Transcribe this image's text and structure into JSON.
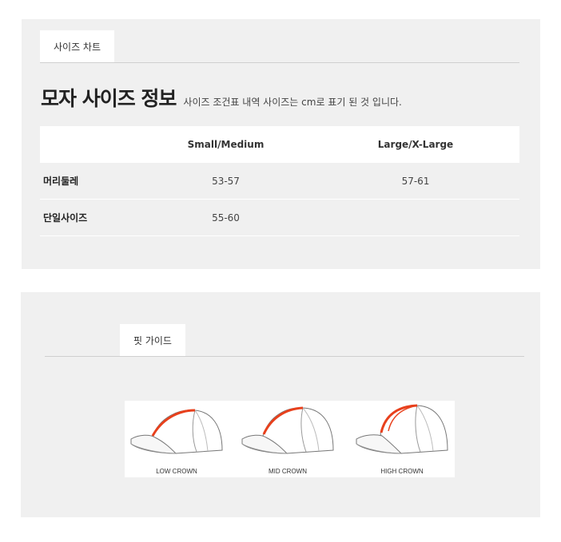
{
  "size_chart": {
    "tab_label": "사이즈 차트",
    "title": "모자 사이즈 정보",
    "subtitle": "사이즈 조건표 내역 사이즈는 cm로 표기 된 것 입니다.",
    "table": {
      "columns": [
        "",
        "Small/Medium",
        "Large/X-Large"
      ],
      "rows": [
        {
          "label": "머리둘레",
          "values": [
            "53-57",
            "57-61"
          ]
        },
        {
          "label": "단일사이즈",
          "values": [
            "55-60",
            ""
          ]
        }
      ]
    }
  },
  "fit_guide": {
    "tab_label": "핏 가이드",
    "crowns": [
      {
        "label": "LOW CROWN",
        "icon": "low-crown-cap-icon"
      },
      {
        "label": "MID CROWN",
        "icon": "mid-crown-cap-icon"
      },
      {
        "label": "HIGH CROWN",
        "icon": "high-crown-cap-icon"
      }
    ]
  },
  "colors": {
    "panel_bg": "#f0f0f0",
    "crown_highlight": "#e8401c"
  }
}
